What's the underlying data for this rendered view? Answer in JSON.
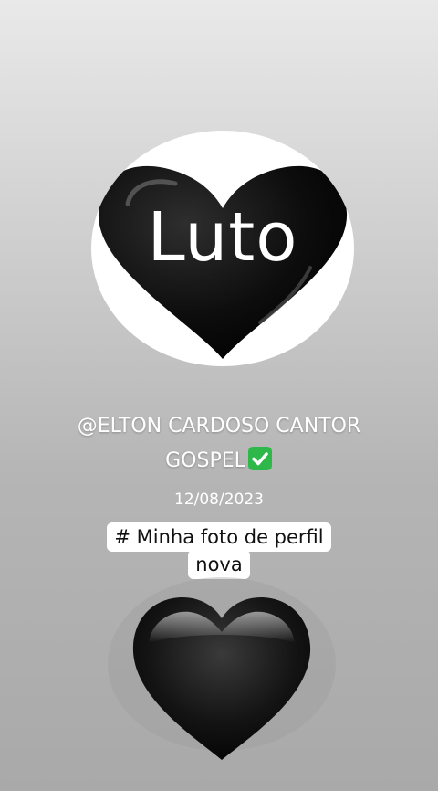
{
  "profile": {
    "heart_text": "Luto",
    "handle_line1": "@ELTON CARDOSO CANTOR",
    "handle_line2": "GOSPEL",
    "verified_icon": "check-mark-emoji",
    "date": "12/08/2023"
  },
  "caption": {
    "line1": "# Minha foto de perfil",
    "line2": "nova"
  },
  "colors": {
    "heart": "#101010",
    "check_green": "#2fb84a",
    "caption_bg": "#ffffff"
  }
}
